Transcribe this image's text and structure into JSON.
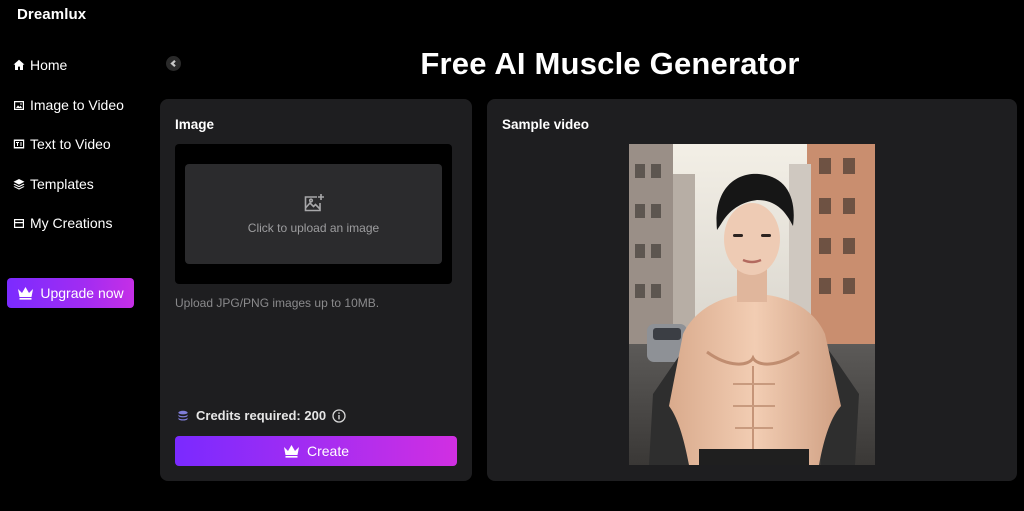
{
  "brand": {
    "name": "Dreamlux"
  },
  "sidebar": {
    "items": [
      {
        "label": "Home",
        "icon": "home-icon"
      },
      {
        "label": "Image to Video",
        "icon": "image-video-icon"
      },
      {
        "label": "Text to Video",
        "icon": "text-video-icon"
      },
      {
        "label": "Templates",
        "icon": "layers-icon"
      },
      {
        "label": "My Creations",
        "icon": "folder-icon"
      }
    ],
    "upgrade_label": "Upgrade now",
    "upgrade_icon": "crown-icon"
  },
  "main": {
    "title": "Free AI Muscle Generator",
    "input_panel": {
      "label": "Image",
      "upload_text": "Click to upload an image",
      "upload_icon": "add-image-icon",
      "hint": "Upload JPG/PNG images up to 10MB.",
      "credits_label": "Credits required: 200",
      "credits_icon": "coins-icon",
      "info_icon": "info-icon",
      "create_label": "Create",
      "create_icon": "crown-icon"
    },
    "sample_panel": {
      "label": "Sample video"
    }
  },
  "colors": {
    "background": "#000000",
    "panel": "#1e1e20",
    "accent_start": "#7a2aff",
    "accent_end": "#d12fe2"
  }
}
